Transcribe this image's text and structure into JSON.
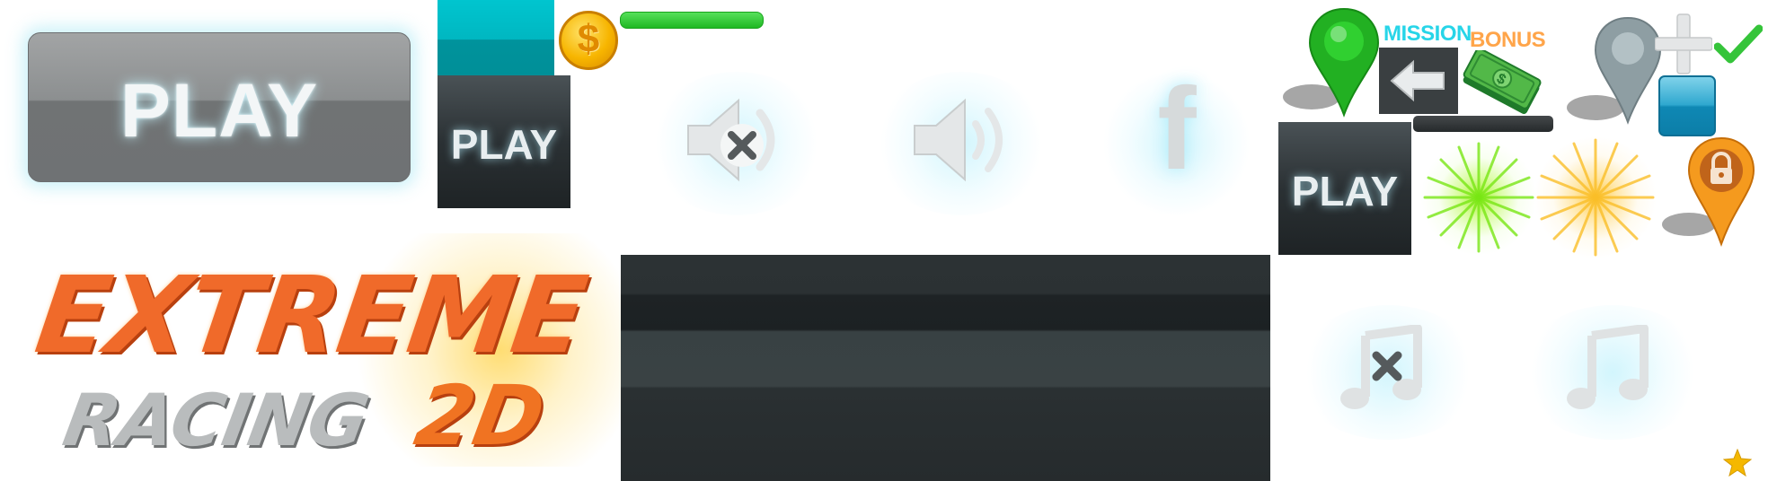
{
  "play_big": {
    "label": "PLAY"
  },
  "play_small_1": {
    "label": "PLAY"
  },
  "play_small_2": {
    "label": "PLAY"
  },
  "coin": {
    "symbol": "$"
  },
  "facebook": {
    "glyph": "f"
  },
  "labels": {
    "mission": "MISSION",
    "bonus": "BONUS"
  },
  "logo": {
    "line1": "EXTREME",
    "line2": "RACING",
    "line3": "2D"
  },
  "colors": {
    "accent_teal": "#00b7c1",
    "logo_orange": "#f06a2a",
    "pin_green": "#22b022",
    "pin_orange": "#f59a1e",
    "check_green": "#35c43a"
  },
  "icons": [
    "coin-icon",
    "speaker-muted-icon",
    "speaker-on-icon",
    "facebook-icon",
    "map-pin-green-icon",
    "back-arrow-icon",
    "money-icon",
    "map-pin-grey-icon",
    "plus-icon",
    "checkmark-icon",
    "burst-green-icon",
    "burst-yellow-icon",
    "lock-pin-icon",
    "music-muted-icon",
    "music-on-icon",
    "star-icon"
  ]
}
